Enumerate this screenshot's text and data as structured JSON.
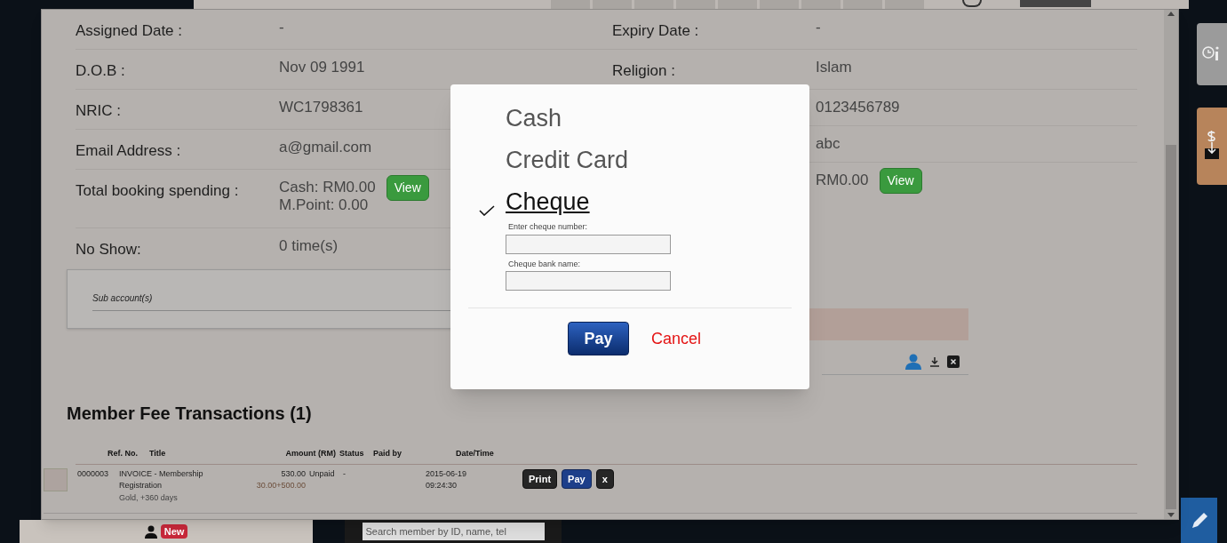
{
  "details": {
    "left": [
      {
        "label": "Assigned Date :",
        "values": [
          "-"
        ]
      },
      {
        "label": "D.O.B :",
        "values": [
          "Nov 09 1991"
        ]
      },
      {
        "label": "NRIC :",
        "values": [
          "WC1798361"
        ]
      },
      {
        "label": "Email Address :",
        "values": [
          "a@gmail.com"
        ]
      },
      {
        "label": "Total booking spending :",
        "values": [
          "Cash: RM0.00",
          "M.Point: 0.00"
        ],
        "button": "View"
      },
      {
        "label": "No Show:",
        "values": [
          "0 time(s)"
        ]
      }
    ],
    "right": [
      {
        "label": "Expiry Date :",
        "values": [
          "-"
        ]
      },
      {
        "label": "Religion :",
        "values": [
          "Islam"
        ]
      },
      {
        "values": [
          "0123456789"
        ]
      },
      {
        "values": [
          "abc"
        ]
      },
      {
        "values": [
          "RM0.00"
        ],
        "button": "View"
      }
    ]
  },
  "sub_accounts": {
    "label": "Sub account(s)"
  },
  "transactions": {
    "title": "Member Fee Transactions (1)",
    "columns": [
      "Ref. No.",
      "Title",
      "Amount (RM)",
      "Status",
      "Paid by",
      "Date/Time"
    ],
    "rows": [
      {
        "ref": "0000003",
        "title": "INVOICE - Membership Registration",
        "note": "Gold, +360 days",
        "amount": "530.00",
        "amount_detail": "30.00+500.00",
        "status": "Unpaid",
        "paid_by": "-",
        "datetime": [
          "2015-06-19",
          "09:24:30"
        ],
        "actions": [
          {
            "label": "Print",
            "kind": "dark"
          },
          {
            "label": "Pay",
            "kind": "blue"
          },
          {
            "label": "x",
            "kind": "dark"
          }
        ]
      }
    ]
  },
  "payment_dialog": {
    "methods": [
      {
        "label": "Cash",
        "selected": false
      },
      {
        "label": "Credit Card",
        "selected": false
      },
      {
        "label": "Cheque",
        "selected": true,
        "fields": [
          {
            "label": "Enter cheque number:"
          },
          {
            "label": "Cheque bank name:"
          }
        ]
      }
    ],
    "pay": "Pay",
    "cancel": "Cancel"
  },
  "bottom_bar": {
    "new_badge": "New",
    "search_placeholder": "Search member by ID, name, tel"
  }
}
